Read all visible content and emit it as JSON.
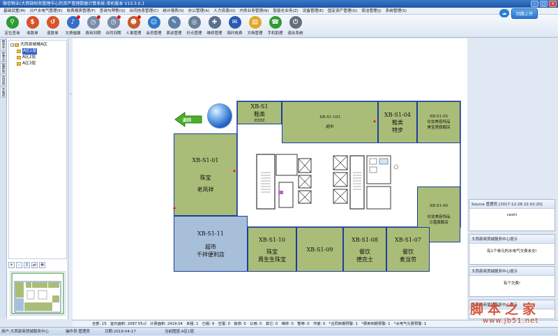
{
  "window": {
    "title": "微信物业(大西部财务管理中心的资产管理数据计算系统-单机版本 V10.3.0.1"
  },
  "menu": [
    "基础设置(M)",
    "分户水电气管理(E)",
    "收费报表管理(F)",
    "查询与预警(Q)",
    "合同信息管理(C)",
    "统计报表(S)",
    "办公管理(A)",
    "人力资源(O)",
    "内务业务管理(N)",
    "智能化业务(Z)",
    "设备管理(E)",
    "固定资产管理(G)",
    "保洁管理(J)",
    "系统管理(S)"
  ],
  "toolbar": [
    {
      "label": "定位查询",
      "icon": "location-pin-icon",
      "color": "#2f9a35",
      "badge": false
    },
    {
      "label": "收款单",
      "icon": "coin-icon",
      "color": "#d8532a",
      "badge": false
    },
    {
      "label": "退款单",
      "icon": "refund-icon",
      "color": "#d8532a",
      "badge": false
    },
    {
      "label": "欠费催缴",
      "icon": "alarm-icon",
      "color": "#3570c7",
      "badge": true
    },
    {
      "label": "费用到期",
      "icon": "clock-icon",
      "color": "#7a8da8",
      "badge": true
    },
    {
      "label": "合同到期",
      "icon": "contract-clock-icon",
      "color": "#7a8da8",
      "badge": true
    },
    {
      "label": "人事管理",
      "icon": "people-icon",
      "color": "#c45a2e",
      "badge": true
    },
    {
      "label": "会员管理",
      "icon": "member-icon",
      "color": "#2e79c8",
      "badge": false
    },
    {
      "label": "面谈管理",
      "icon": "interview-icon",
      "color": "#5d7ea6",
      "badge": false
    },
    {
      "label": "抄点管理",
      "icon": "meter-icon",
      "color": "#6a7f98",
      "badge": false
    },
    {
      "label": "维修管理",
      "icon": "repair-icon",
      "color": "#5c6f8a",
      "badge": false
    },
    {
      "label": "临时收费",
      "icon": "cash-icon",
      "color": "#2a5caf",
      "badge": false
    },
    {
      "label": "文档管理",
      "icon": "folder-icon",
      "color": "#e0a82a",
      "badge": false
    },
    {
      "label": "手机助理",
      "icon": "phone-icon",
      "color": "#2f9a35",
      "badge": false
    },
    {
      "label": "退出系统",
      "icon": "power-icon",
      "color": "#666e7a",
      "badge": false
    }
  ],
  "upload": {
    "label": "回路上传"
  },
  "left_tabs": [
    "楼宇平面图",
    "经营业态",
    "面积管理",
    "合同管理",
    "水电管理"
  ],
  "tree": {
    "root": "大西部城楼A区",
    "children": [
      "A区1层",
      "A区2层",
      "A区3层"
    ]
  },
  "mini_tools": [
    "+",
    "-",
    "↕",
    "⇄",
    "✥"
  ],
  "return_label": "返回",
  "shops": [
    {
      "code": "XB-S1",
      "line1": "鞋类",
      "line2": "ZZZZ",
      "tone": "olive"
    },
    {
      "code": "XB-S1-103",
      "line1": "超市",
      "line2": "",
      "tone": "olive"
    },
    {
      "code": "XB-S1-04",
      "line1": "鞋类",
      "line2": "特步",
      "tone": "olive"
    },
    {
      "code": "XB-S1-05",
      "line1": "化妆美容饰品",
      "line2": "美宝莲旗舰店",
      "tone": "olive"
    },
    {
      "code": "XB-S1-01",
      "line1": "珠宝",
      "line2": "老凤祥",
      "tone": "olive"
    },
    {
      "code": "XB-S1-06",
      "line1": "化妆美容饰品",
      "line2": "兰蔻旗舰店",
      "tone": "olive"
    },
    {
      "code": "XB-S1-11",
      "line1": "超市",
      "line2": "千祥便利店",
      "tone": "blue"
    },
    {
      "code": "XB-S1-10",
      "line1": "珠宝",
      "line2": "周生生珠宝",
      "tone": "olive"
    },
    {
      "code": "XB-S1-09",
      "line1": "",
      "line2": "",
      "tone": "olive"
    },
    {
      "code": "XB-S1-08",
      "line1": "餐饮",
      "line2": "德克士",
      "tone": "olive"
    },
    {
      "code": "XB-S1-07",
      "line1": "餐饮",
      "line2": "麦当劳",
      "tone": "olive"
    }
  ],
  "notifications": [
    {
      "header": "Source 管理员 [2017-12-28 22:02:20]",
      "body": "ceshi"
    },
    {
      "header": "大西部商贸城服务中心提示",
      "body": "有1个单元的水电气欠费未交!"
    },
    {
      "header": "大西部商贸城服务中心提示",
      "body": "有个欠费!"
    },
    {
      "header": "大西部商贸城服务中心提示",
      "body": ""
    }
  ],
  "status": "全部: 15　室内面积: 2087.55㎡　计费面积: 2419.04　未租: 1　已租: 9　空置: 0　装修: 0　公用: 0　其它: 0　维修: 0　暂停: 0　作废: 0　*合同到期预警: 1　*费用到期预警: 1　*水电气欠费预警: 1",
  "bottom": {
    "user": "用户:大西部商贸城服务中心",
    "operator": "操作员:管理员",
    "date": "日期:2019-04-17",
    "current": "当前图层:A区1层"
  },
  "watermark": {
    "line1": "脚本之家",
    "line2": "www.jb51.net"
  }
}
